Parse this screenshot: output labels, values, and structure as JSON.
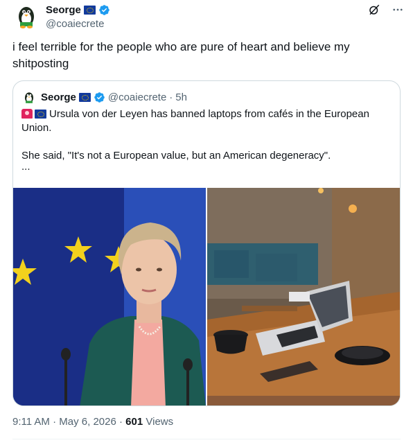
{
  "author": {
    "name": "Seorge",
    "handle": "@coaiecrete",
    "avatar": "penguin-avatar"
  },
  "tweet": {
    "text": "i feel terrible for the people who are pure of heart and believe my shitposting"
  },
  "quote": {
    "name": "Seorge",
    "handle": "@coaiecrete",
    "separator": "·",
    "time": "5h",
    "line1": "Ursula von der Leyen has banned laptops from cafés in the European Union.",
    "line2": "She said, \"It's not a European value, but an American degeneracy\".",
    "more": "..."
  },
  "meta": {
    "time": "9:11 AM",
    "separator1": "·",
    "date": "May 6, 2026",
    "separator2": "·",
    "views": "601",
    "views_label": "Views"
  },
  "colors": {
    "accent": "#1d9bf0",
    "text": "#0f1419",
    "secondary": "#536471",
    "border": "#cfd9de"
  }
}
